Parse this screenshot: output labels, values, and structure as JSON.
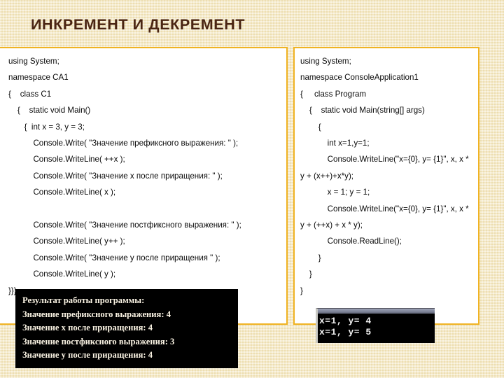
{
  "slide": {
    "title": "ИНКРЕМЕНТ И ДЕКРЕМЕНТ",
    "background_color": "#f4e7c0",
    "title_color": "#4a2512",
    "panel_border_color": "#f0b323",
    "panel_background": "#ffffff",
    "console_background": "#000000",
    "console_text_color": "#fbf4e4"
  },
  "left_panel": {
    "lines": [
      "using System;",
      "namespace CA1",
      "{    class C1",
      "    {    static void Main()",
      "       {  int x = 3, y = 3;",
      "           Console.Write( \"Значение префиксного выражения: \" );",
      "           Console.WriteLine( ++x );",
      "           Console.Write( \"Значение х после приращения: \" );",
      "           Console.WriteLine( x );",
      "",
      "           Console.Write( \"Значение постфиксного выражения: \" );",
      "           Console.WriteLine( y++ );",
      "           Console.Write( \"Значение у после приращения \" );",
      "           Console.WriteLine( y );",
      "}}}"
    ]
  },
  "right_panel": {
    "lines": [
      "using System;",
      "namespace ConsoleApplication1",
      "{     class Program",
      "    {    static void Main(string[] args)",
      "        {",
      "            int x=1,y=1;",
      "            Console.WriteLine(\"x={0}, y= {1}\", x, x * y + (x++)+x*y);",
      "            x = 1; y = 1;",
      "            Console.WriteLine(\"x={0}, y= {1}\", x, x * y + (++x) + x * y);",
      "            Console.ReadLine();",
      "        }",
      "    }",
      "}"
    ]
  },
  "left_console": {
    "lines": [
      "Результат работы программы:",
      "Значение префиксного выражения: 4",
      "Значение х после приращения: 4",
      "Значение постфиксного выражения: 3",
      "Значение у после приращения: 4"
    ]
  },
  "right_console": {
    "lines": [
      "x=1, y= 4",
      "x=1, y= 5"
    ]
  }
}
